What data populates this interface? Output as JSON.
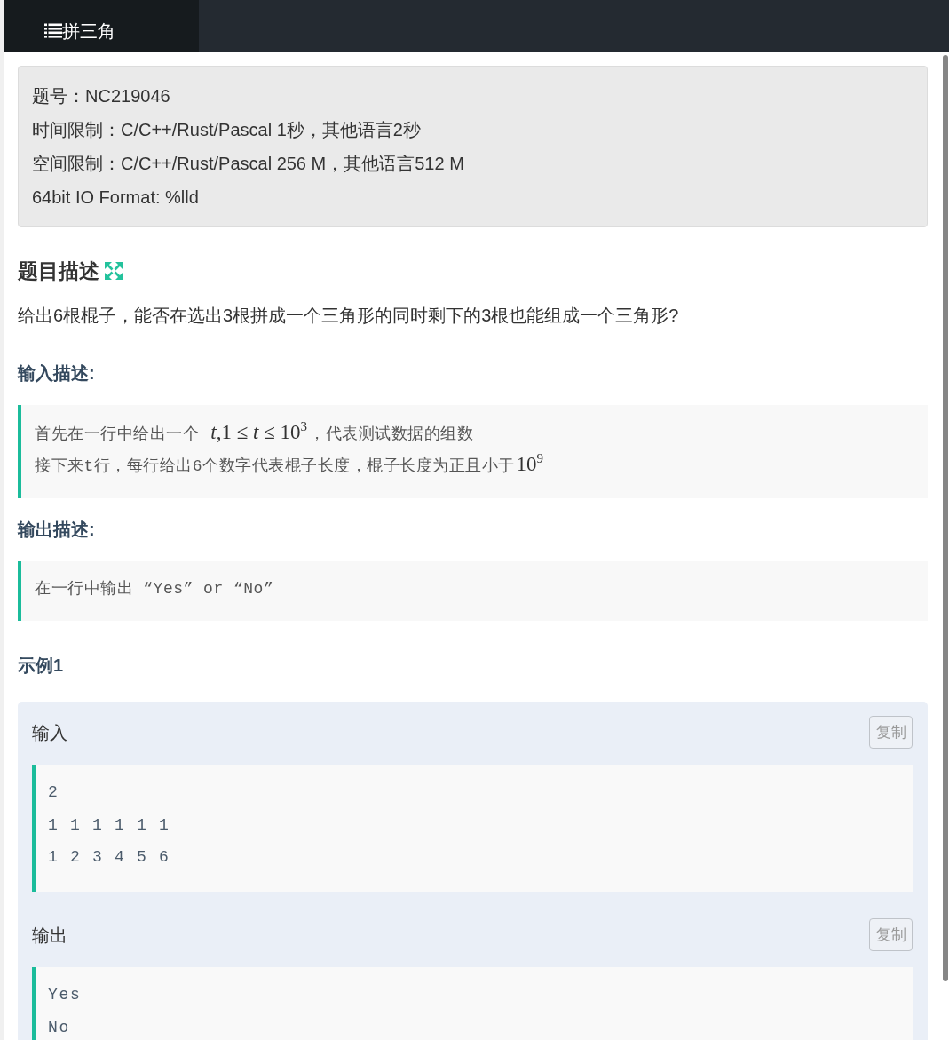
{
  "tab": {
    "title": "拼三角"
  },
  "info": {
    "lines": [
      "题号：NC219046",
      "时间限制：C/C++/Rust/Pascal 1秒，其他语言2秒",
      "空间限制：C/C++/Rust/Pascal 256 M，其他语言512 M",
      "64bit IO Format: %lld"
    ]
  },
  "description": {
    "heading": "题目描述",
    "text": "给出6根棍子，能否在选出3根拼成一个三角形的同时剩下的3根也能组成一个三角形?"
  },
  "sections": [
    {
      "heading": "输入描述:",
      "lines": [
        [
          {
            "kind": "text",
            "text": "首先在一行中给出一个 "
          },
          {
            "kind": "math",
            "text": "*t*,1 ≤ *t* ≤ 10$^{3}$"
          },
          {
            "kind": "text",
            "text": "，代表测试数据的组数"
          }
        ],
        [
          {
            "kind": "text",
            "text": "接下来t行，每行给出6个数字代表棍子长度，棍子长度为正且小于"
          },
          {
            "kind": "math",
            "text": "10$^{9}$"
          }
        ]
      ]
    },
    {
      "heading": "输出描述:",
      "lines": [
        [
          {
            "kind": "text",
            "text": "在一行中输出 “Yes” or “No”"
          }
        ]
      ]
    }
  ],
  "example": {
    "heading": "示例1",
    "blocks": [
      {
        "label": "输入",
        "button": "复制",
        "lines": [
          "2",
          "1 1 1 1 1 1",
          "1 2 3 4 5 6"
        ]
      },
      {
        "label": "输出",
        "button": "复制",
        "lines": [
          "Yes",
          "No"
        ]
      }
    ]
  }
}
